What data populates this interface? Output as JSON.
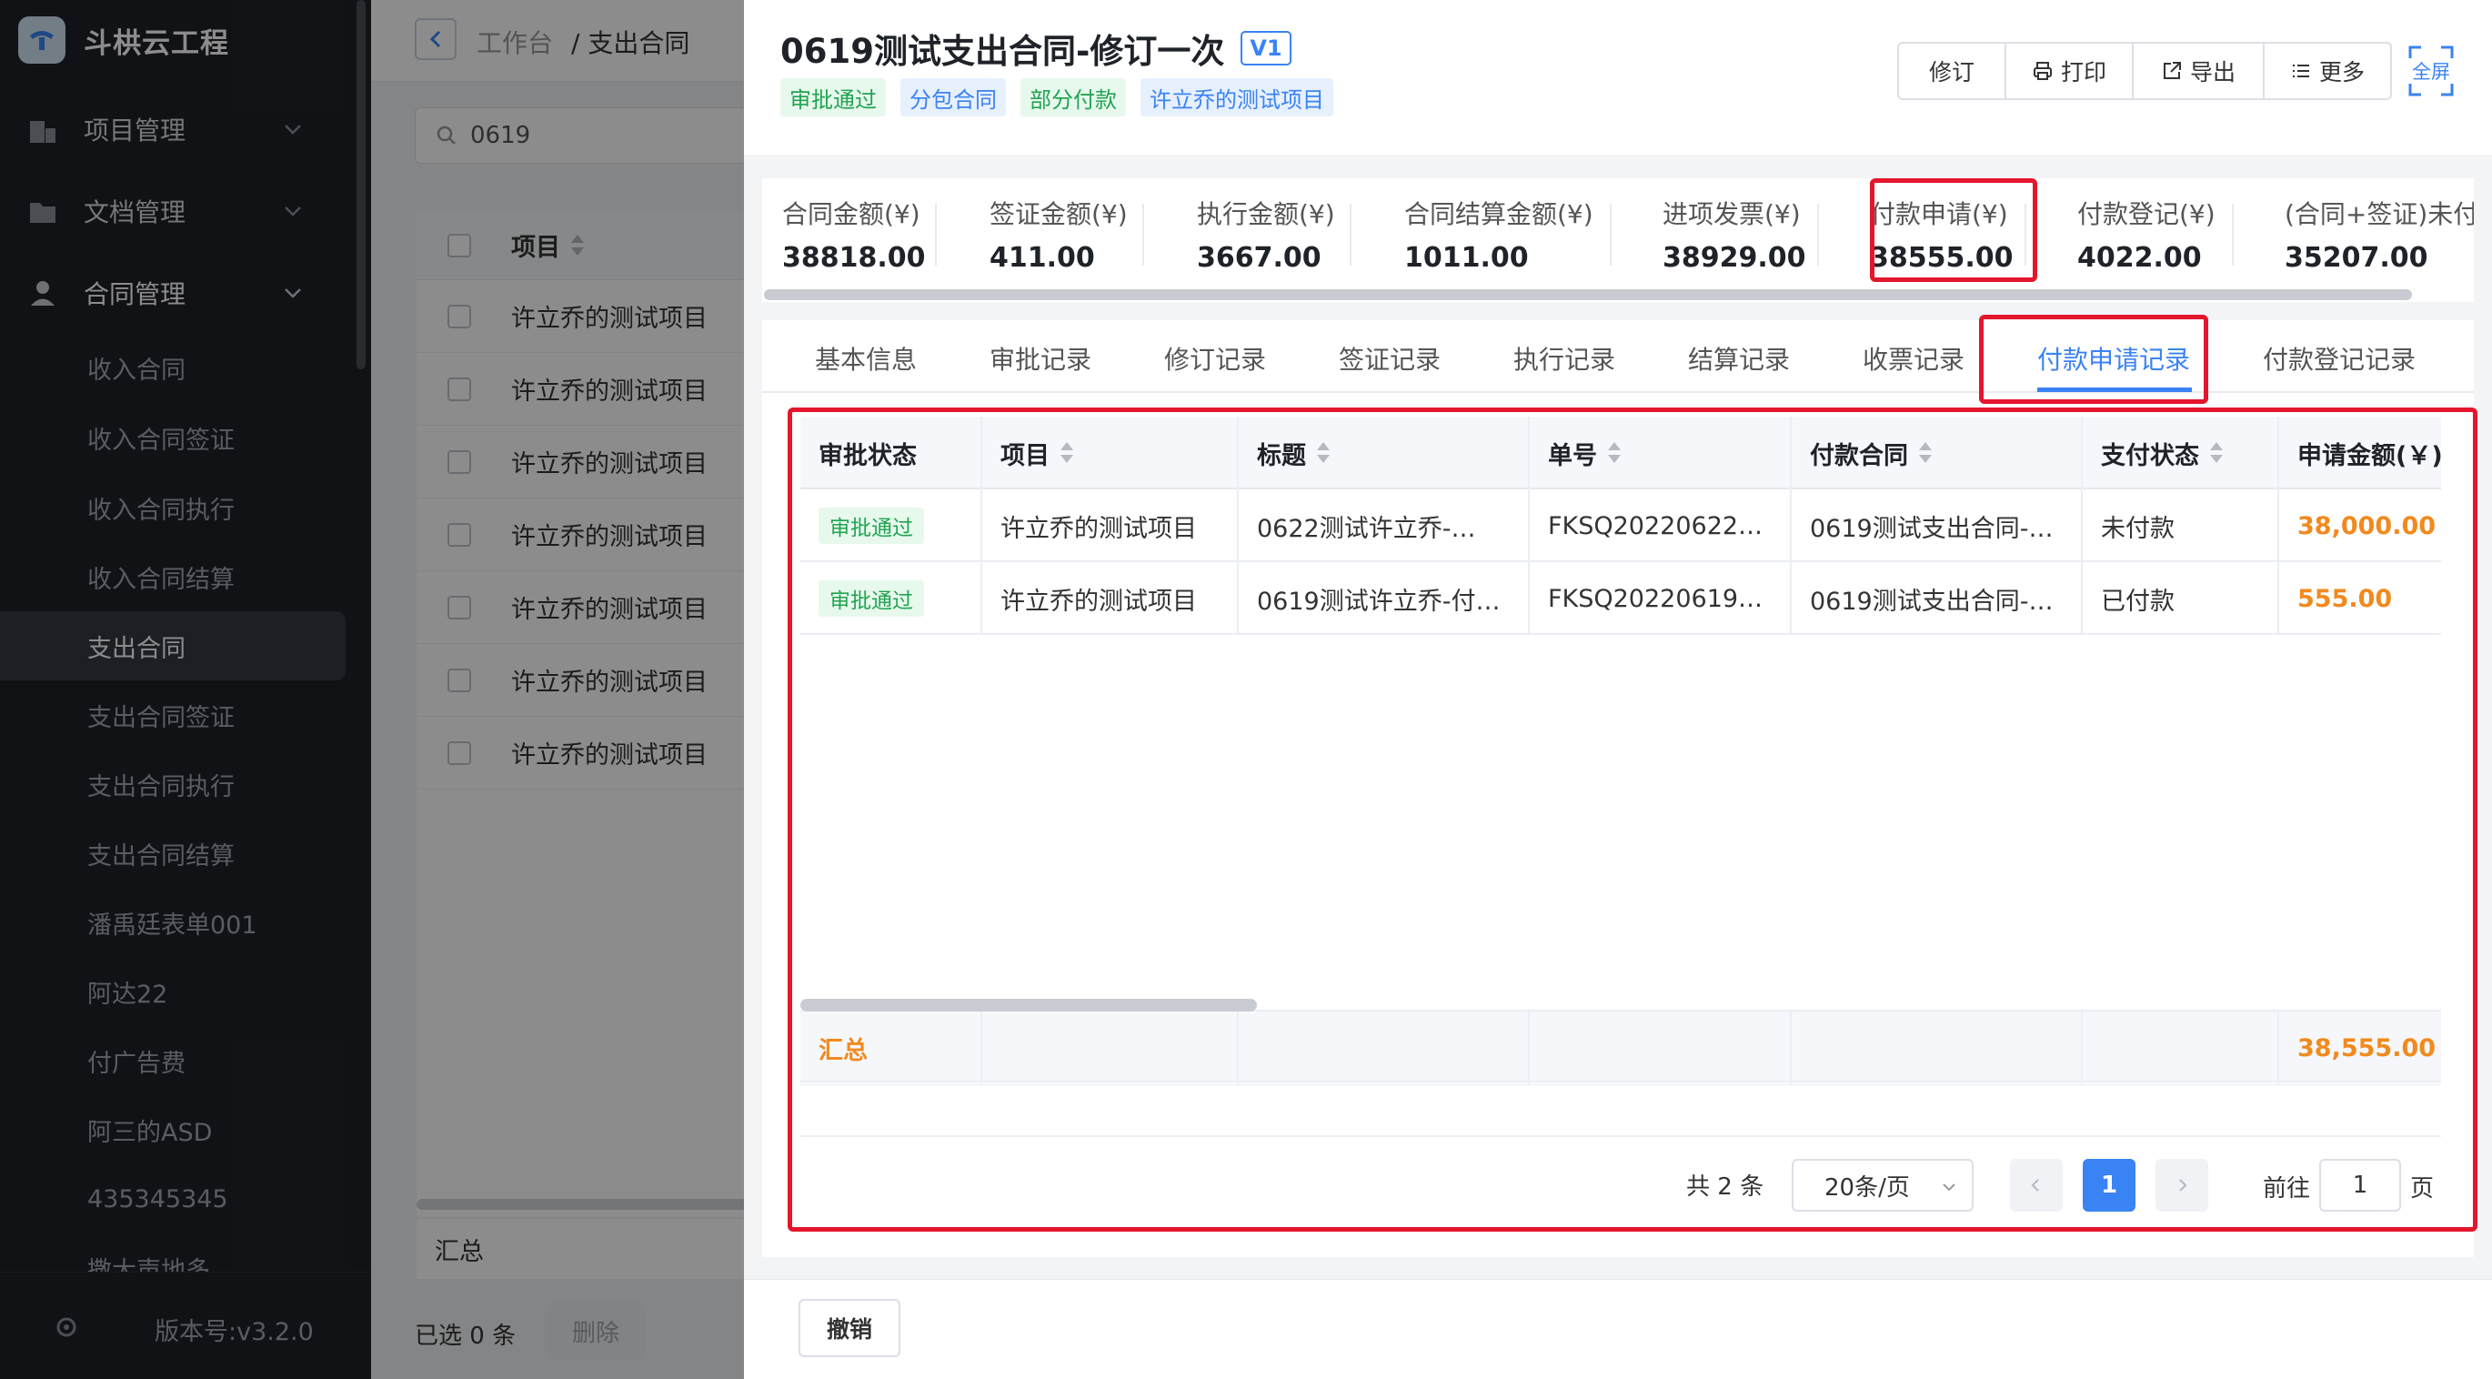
{
  "app": {
    "name": "斗栱云工程",
    "version": "版本号:v3.2.0"
  },
  "sidebar": {
    "menus": [
      {
        "label": "项目管理",
        "icon": "building-icon"
      },
      {
        "label": "文档管理",
        "icon": "folder-icon"
      },
      {
        "label": "合同管理",
        "icon": "person-icon"
      }
    ],
    "items": [
      "收入合同",
      "收入合同签证",
      "收入合同执行",
      "收入合同结算",
      "支出合同",
      "支出合同签证",
      "支出合同执行",
      "支出合同结算",
      "潘禹廷表单001",
      "阿达22",
      "付广告费",
      "阿三的ASD",
      "435345345",
      "撒大声地多"
    ],
    "active": "支出合同"
  },
  "background_page": {
    "breadcrumb": [
      "工作台",
      "/ 支出合同"
    ],
    "search_value": "0619",
    "column_project": "项目",
    "rows": [
      "许立乔的测试项目",
      "许立乔的测试项目",
      "许立乔的测试项目",
      "许立乔的测试项目",
      "许立乔的测试项目",
      "许立乔的测试项目",
      "许立乔的测试项目"
    ],
    "summary_label": "汇总",
    "selected_text": "已选 0 条",
    "delete_label": "删除"
  },
  "drawer": {
    "title": "0619测试支出合同-修订一次",
    "version_badge": "V1",
    "tags": [
      {
        "label": "审批通过",
        "color": "#21a453"
      },
      {
        "label": "分包合同",
        "color": "#3a83f4"
      },
      {
        "label": "部分付款",
        "color": "#21a453"
      },
      {
        "label": "许立乔的测试项目",
        "color": "#3a83f4"
      }
    ],
    "buttons": {
      "revise": "修订",
      "print": "打印",
      "export": "导出",
      "more": "更多",
      "fullscreen": "全屏"
    },
    "stats": [
      {
        "label": "合同金额(¥)",
        "value": "38818.00"
      },
      {
        "label": "签证金额(¥)",
        "value": "411.00"
      },
      {
        "label": "执行金额(¥)",
        "value": "3667.00"
      },
      {
        "label": "合同结算金额(¥)",
        "value": "1011.00"
      },
      {
        "label": "进项发票(¥)",
        "value": "38929.00"
      },
      {
        "label": "付款申请(¥)",
        "value": "38555.00"
      },
      {
        "label": "付款登记(¥)",
        "value": "4022.00"
      },
      {
        "label": "(合同+签证)未付",
        "value": "35207.00"
      }
    ],
    "tabs": [
      "基本信息",
      "审批记录",
      "修订记录",
      "签证记录",
      "执行记录",
      "结算记录",
      "收票记录",
      "付款申请记录",
      "付款登记记录"
    ],
    "active_tab": "付款申请记录",
    "table": {
      "columns": [
        "审批状态",
        "项目",
        "标题",
        "单号",
        "付款合同",
        "支付状态",
        "申请金额(￥)"
      ],
      "rows": [
        {
          "status": "审批通过",
          "project": "许立乔的测试项目",
          "title": "0622测试许立乔-…",
          "number": "FKSQ20220622…",
          "contract": "0619测试支出合同-…",
          "pay_status": "未付款",
          "amount": "38,000.00"
        },
        {
          "status": "审批通过",
          "project": "许立乔的测试项目",
          "title": "0619测试许立乔-付…",
          "number": "FKSQ20220619…",
          "contract": "0619测试支出合同-…",
          "pay_status": "已付款",
          "amount": "555.00"
        }
      ],
      "summary_label": "汇总",
      "summary_amount": "38,555.00"
    },
    "pagination": {
      "total": "共 2 条",
      "page_size": "20条/页",
      "current": "1",
      "goto_label": "前往",
      "goto_value": "1",
      "page_unit": "页"
    },
    "cancel_label": "撤销"
  },
  "colors": {
    "accent": "#3a83f4",
    "highlight": "#e3162d",
    "amount": "#f18a1e",
    "sidebar": "#1f2229"
  }
}
